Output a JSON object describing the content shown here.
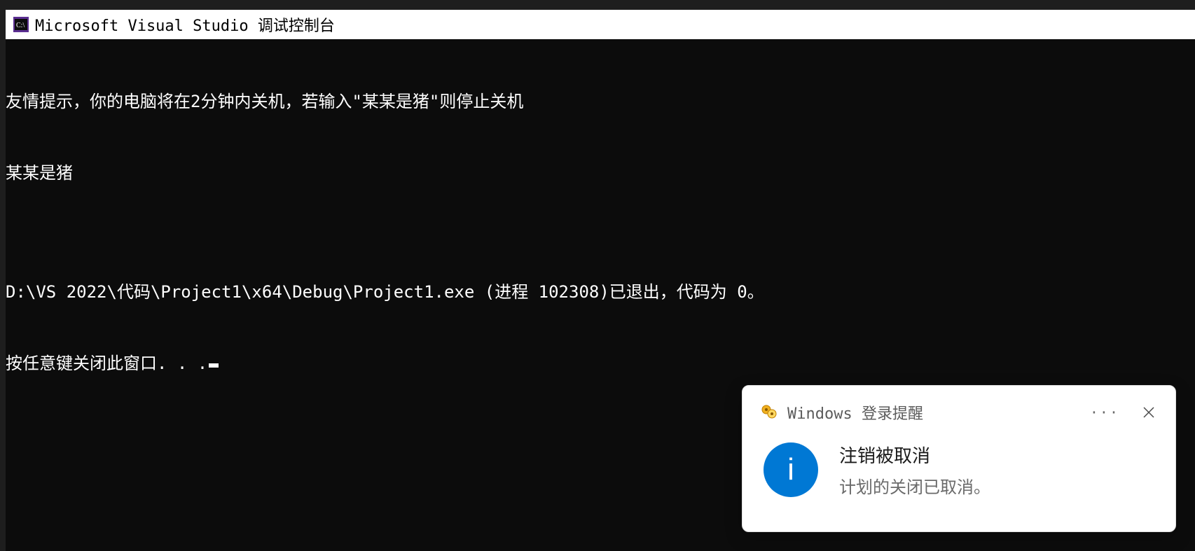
{
  "window": {
    "title": "Microsoft Visual Studio 调试控制台",
    "icon_name": "console-icon"
  },
  "console": {
    "lines": [
      "友情提示，你的电脑将在2分钟内关机，若输入\"某某是猪\"则停止关机",
      "某某是猪",
      "",
      "D:\\VS 2022\\代码\\Project1\\x64\\Debug\\Project1.exe (进程 102308)已退出，代码为 0。",
      "按任意键关闭此窗口. . ."
    ]
  },
  "toast": {
    "app_title": "Windows 登录提醒",
    "heading": "注销被取消",
    "message": "计划的关闭已取消。",
    "info_letter": "i",
    "ellipsis": "···"
  }
}
